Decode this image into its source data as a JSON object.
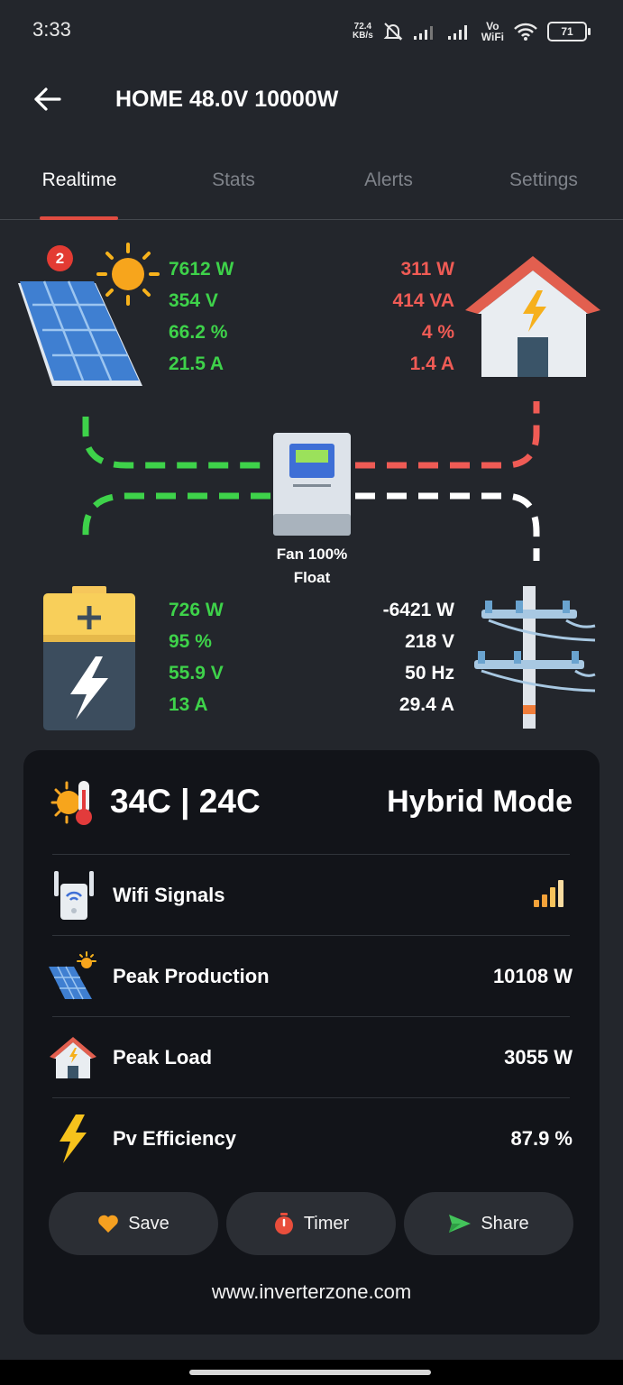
{
  "status_bar": {
    "time": "3:33",
    "speed_value": "72.4",
    "speed_unit": "KB/s",
    "vowifi_top": "Vo",
    "vowifi_bottom": "WiFi",
    "battery": "71"
  },
  "header": {
    "title": "HOME 48.0V 10000W"
  },
  "tabs": [
    {
      "label": "Realtime"
    },
    {
      "label": "Stats"
    },
    {
      "label": "Alerts"
    },
    {
      "label": "Settings"
    }
  ],
  "solar": {
    "badge": "2",
    "values": [
      "7612 W",
      "354 V",
      "66.2 %",
      "21.5 A"
    ]
  },
  "load": {
    "values": [
      "311 W",
      "414 VA",
      "4 %",
      "1.4 A"
    ]
  },
  "inverter": {
    "status_line1": "Fan 100%",
    "status_line2": "Float"
  },
  "battery": {
    "values": [
      "726 W",
      "95 %",
      "55.9 V",
      "13 A"
    ]
  },
  "grid": {
    "values": [
      "-6421 W",
      "218 V",
      "50 Hz",
      "29.4 A"
    ]
  },
  "card": {
    "temperature": "34C | 24C",
    "mode": "Hybrid Mode",
    "rows": [
      {
        "label": "Wifi Signals",
        "value": ""
      },
      {
        "label": "Peak Production",
        "value": "10108 W"
      },
      {
        "label": "Peak Load",
        "value": "3055 W"
      },
      {
        "label": "Pv Efficiency",
        "value": "87.9 %"
      }
    ],
    "buttons": [
      {
        "label": "Save"
      },
      {
        "label": "Timer"
      },
      {
        "label": "Share"
      }
    ],
    "website": "www.inverterzone.com"
  },
  "colors": {
    "solar": "#3ed24a",
    "load": "#ef5b55",
    "grid": "#ffffff",
    "accent": "#e04c41"
  },
  "icons": [
    "back-arrow-icon",
    "solar-panel-icon",
    "sun-icon",
    "house-icon",
    "inverter-icon",
    "battery-icon",
    "power-pole-icon",
    "thermometer-icon",
    "wifi-extender-icon",
    "signal-bars-icon",
    "lightning-icon",
    "heart-icon",
    "timer-icon",
    "send-icon"
  ]
}
